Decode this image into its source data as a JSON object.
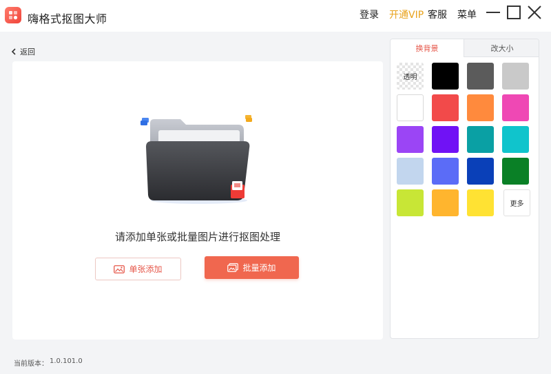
{
  "app": {
    "title": "嗨格式抠图大师"
  },
  "top_menu": {
    "login": "登录",
    "vip": "开通VIP",
    "service": "客服",
    "menu": "菜单"
  },
  "nav": {
    "back_label": "返回"
  },
  "main": {
    "prompt": "请添加单张或批量图片进行抠图处理",
    "single_add_label": "单张添加",
    "batch_add_label": "批量添加"
  },
  "side_panel": {
    "tabs": [
      {
        "label": "换背景",
        "active": true
      },
      {
        "label": "改大小",
        "active": false
      }
    ],
    "transparent_label": "透明",
    "more_label": "更多",
    "swatch_colors": [
      "#000000",
      "#5b5b5b",
      "#c9c9c9",
      "#ffffff",
      "#f24a4a",
      "#ff8a3d",
      "#ef48b4",
      "#9b45f5",
      "#7012f5",
      "#0aa0a4",
      "#10c4cc",
      "#c2d6ee",
      "#5b6cf7",
      "#0a40b8",
      "#0a8026",
      "#c8e636",
      "#ffb52e",
      "#ffe233"
    ]
  },
  "footer": {
    "version_label": "当前版本：",
    "version_value": "1.0.101.0"
  },
  "colors": {
    "accent": "#f0674f",
    "vip": "#e8a21b"
  }
}
